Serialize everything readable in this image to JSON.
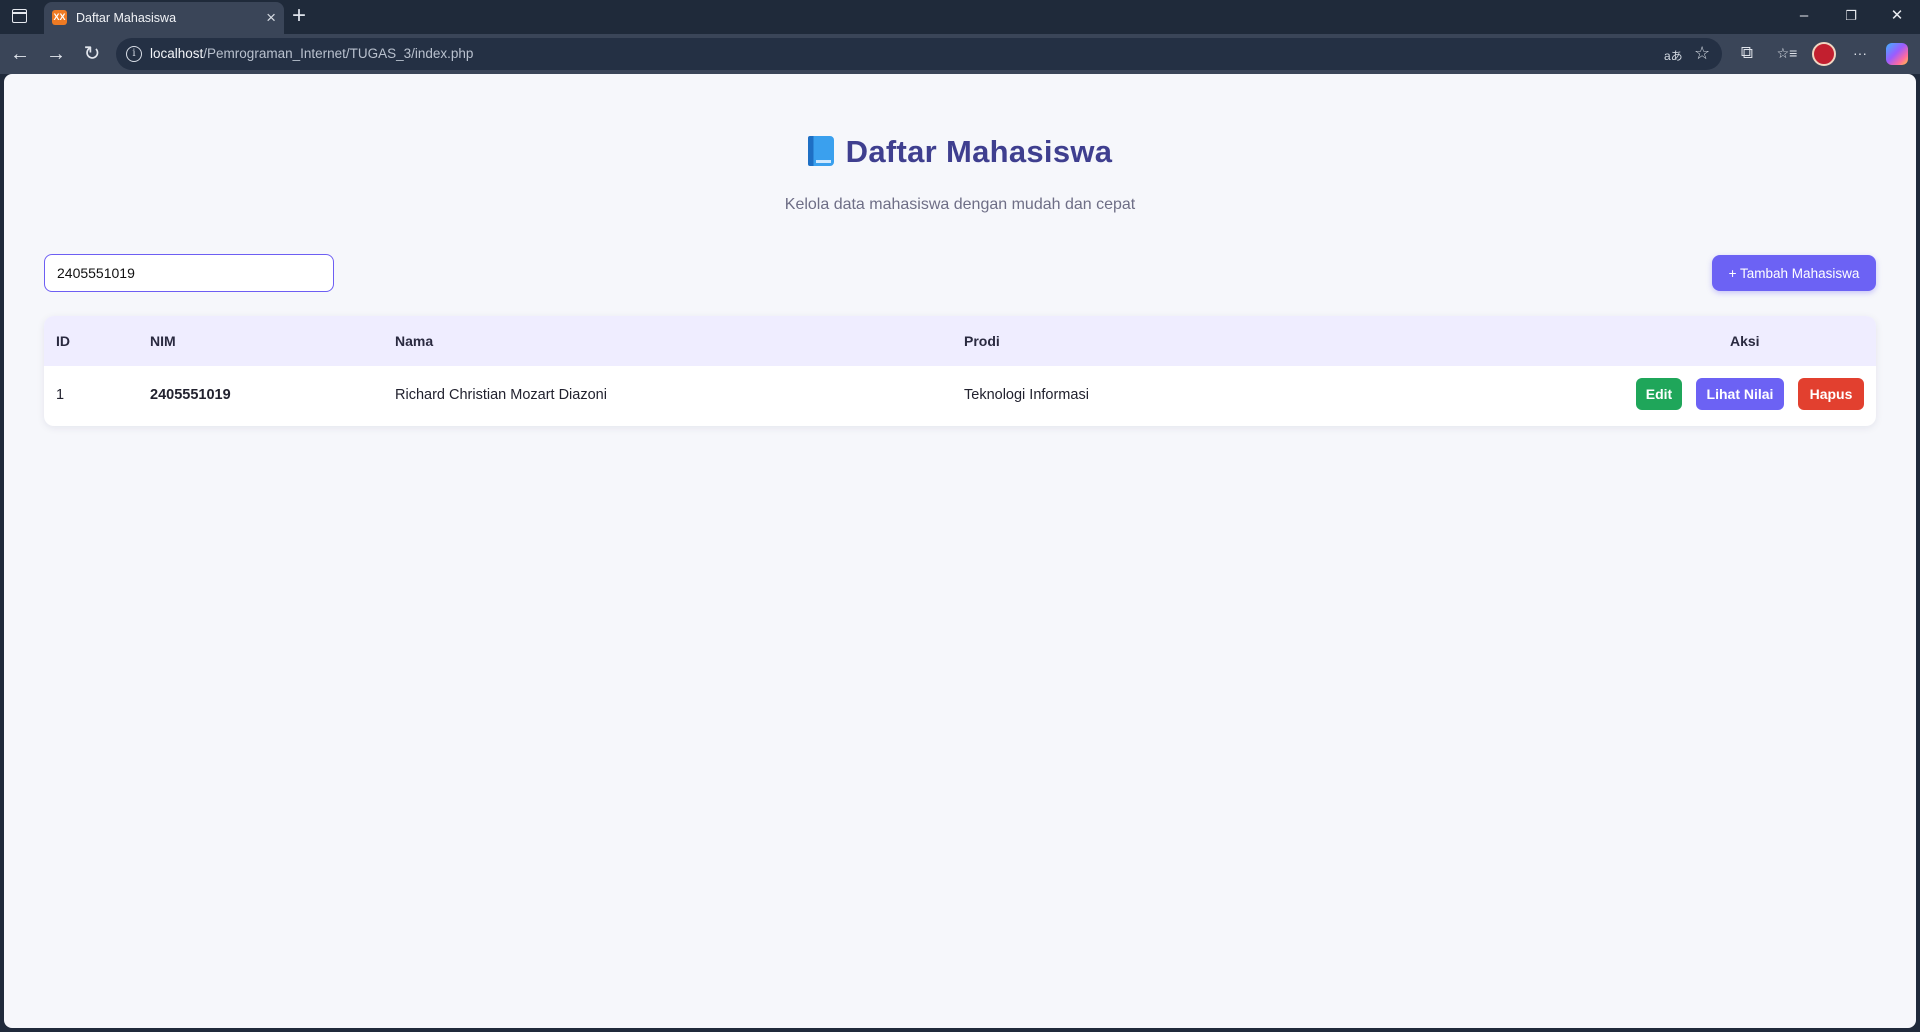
{
  "browser": {
    "tab_title": "Daftar Mahasiswa",
    "tab_favicon": "XX",
    "tab_close": "×",
    "new_tab": "+",
    "url_host": "localhost",
    "url_path": "/Pemrograman_Internet/TUGAS_3/index.php",
    "window_controls": {
      "minimize": "–",
      "restore": "❐",
      "close": "✕"
    },
    "nav": {
      "back": "←",
      "forward": "→",
      "reload": "↻"
    },
    "icons": {
      "read_aloud": "aあ",
      "favorite": "☆",
      "extensions": "⧉",
      "favorites": "☆≡",
      "more": "···"
    }
  },
  "page": {
    "title": "Daftar Mahasiswa",
    "title_icon": "blue-book-icon",
    "subtitle": "Kelola data mahasiswa dengan mudah dan cepat",
    "search_value": "2405551019",
    "add_button": "+ Tambah Mahasiswa",
    "accent_color": "#6c62f4"
  },
  "table": {
    "headers": [
      "ID",
      "NIM",
      "Nama",
      "Prodi",
      "Aksi"
    ],
    "rows": [
      {
        "id": "1",
        "nim": "2405551019",
        "nama": "Richard Christian Mozart Diazoni",
        "prodi": "Teknologi Informasi",
        "actions": [
          "Edit",
          "Lihat Nilai",
          "Hapus"
        ]
      }
    ]
  }
}
